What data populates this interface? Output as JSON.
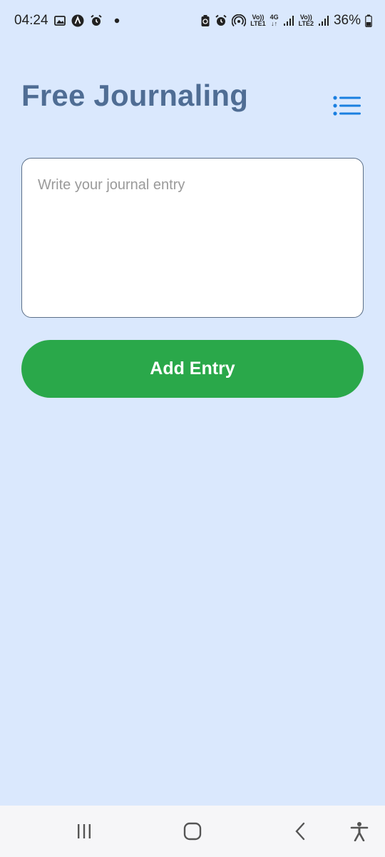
{
  "status_bar": {
    "time": "04:24",
    "battery_percent": "36%",
    "icons_left": [
      "gallery-icon",
      "app-a-icon",
      "alarm-icon",
      "notification-dot"
    ],
    "icons_right": [
      "battery-saver-icon",
      "alarm-icon",
      "hotspot-icon",
      "volte-lte1",
      "4g-data",
      "signal-1",
      "volte-lte2",
      "signal-2",
      "battery-icon"
    ],
    "volte_label": "Vo))",
    "lte1_label": "LTE1",
    "lte2_label": "LTE2",
    "network_label": "4G"
  },
  "header": {
    "title": "Free Journaling",
    "menu_icon": "list-menu-icon"
  },
  "journal_input": {
    "value": "",
    "placeholder": "Write your journal entry"
  },
  "add_button": {
    "label": "Add Entry"
  },
  "colors": {
    "background": "#dae8fd",
    "title": "#4f6d94",
    "accent_blue": "#1a7fe0",
    "button_green": "#2aa84a",
    "input_border": "#5b6f88"
  },
  "nav_bar": {
    "items": [
      "recent-apps-icon",
      "home-icon",
      "back-icon",
      "accessibility-icon"
    ]
  }
}
